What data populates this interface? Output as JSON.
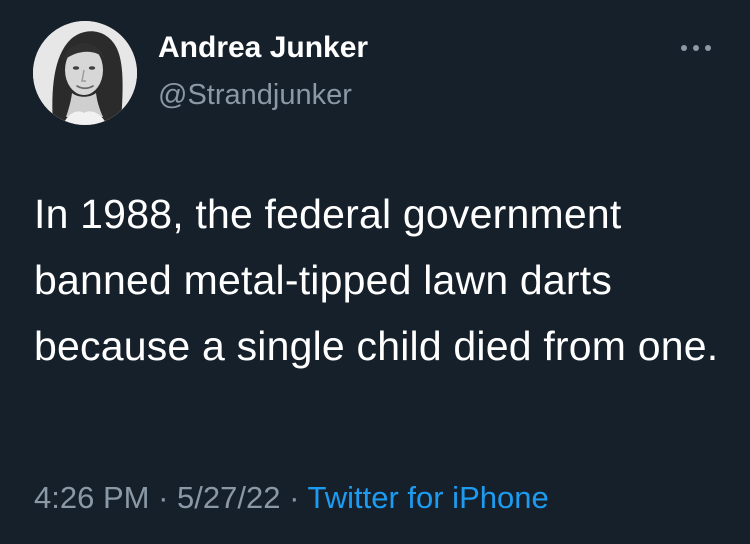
{
  "tweet": {
    "author_name": "Andrea Junker",
    "author_handle": "@Strandjunker",
    "text": "In 1988, the federal government banned metal-tipped lawn darts because a single child died from one.",
    "time": "4:26 PM",
    "date": "5/27/22",
    "source": "Twitter for iPhone",
    "separator": "·"
  },
  "icons": {
    "avatar": "avatar-photo",
    "more": "more-options-icon"
  },
  "colors": {
    "background": "#15202b",
    "primary_text": "#ffffff",
    "secondary_text": "#8b98a5",
    "link": "#1d9bf0"
  }
}
